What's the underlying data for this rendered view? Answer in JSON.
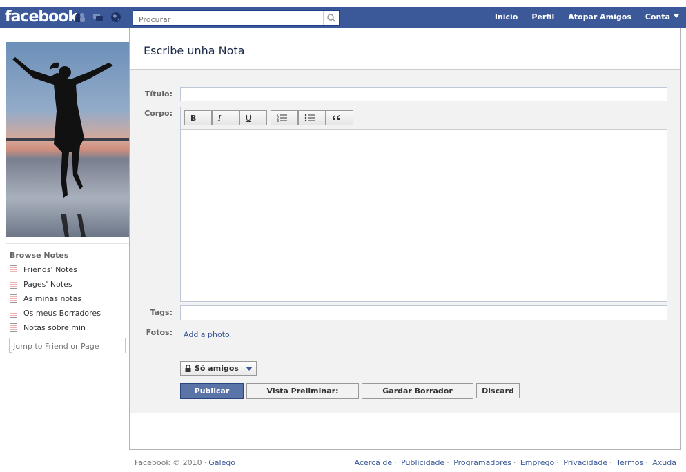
{
  "header": {
    "logo": "facebook",
    "search_placeholder": "Procurar",
    "nav": [
      "Inicio",
      "Perfil",
      "Atopar Amigos",
      "Conta"
    ]
  },
  "sidebar": {
    "browse_title": "Browse Notes",
    "items": [
      {
        "label": "Friends' Notes"
      },
      {
        "label": "Pages' Notes"
      },
      {
        "label": "As miñas notas"
      },
      {
        "label": "Os meus Borradores"
      },
      {
        "label": "Notas sobre min"
      }
    ],
    "jump_placeholder": "Jump to Friend or Page"
  },
  "main": {
    "title": "Escribe unha Nota",
    "labels": {
      "title": "Título:",
      "body": "Corpo:",
      "tags": "Tags:",
      "photos": "Fotos:"
    },
    "toolbar": {
      "bold": "B",
      "italic": "I",
      "underline": "U"
    },
    "add_photo": "Add a photo.",
    "privacy": "Só amigos",
    "buttons": {
      "publish": "Publicar",
      "preview": "Vista Preliminar:",
      "save_draft": "Gardar Borrador",
      "discard": "Discard"
    }
  },
  "footer": {
    "copyright": "Facebook © 2010",
    "language": "Galego",
    "links": [
      "Acerca de",
      "Publicidade",
      "Programadores",
      "Emprego",
      "Privacidade",
      "Termos",
      "Axuda"
    ]
  },
  "colors": {
    "brand": "#3b5998",
    "publish": "#5b74a8"
  }
}
